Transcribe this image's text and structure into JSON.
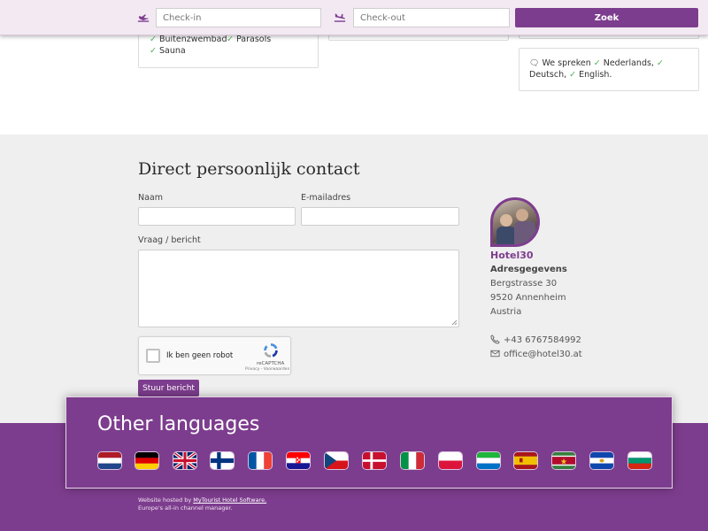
{
  "booking": {
    "checkin_placeholder": "Check-in",
    "checkout_placeholder": "Check-out",
    "search_label": "Zoek"
  },
  "amenities": [
    {
      "label": "Buitenzwembad"
    },
    {
      "label": "Parasols"
    },
    {
      "label": "Sauna"
    }
  ],
  "languages_spoken": {
    "intro": "We spreken",
    "items": [
      "Nederlands,",
      "Deutsch,",
      "English."
    ]
  },
  "contact": {
    "title": "Direct persoonlijk contact",
    "name_label": "Naam",
    "email_label": "E-mailadres",
    "question_label": "Vraag / bericht",
    "captcha_label": "Ik ben geen robot",
    "captcha_brand": "reCAPTCHA",
    "captcha_links": "Privacy - Voorwaarden",
    "send_label": "Stuur bericht"
  },
  "hotel": {
    "name": "Hotel30",
    "address_title": "Adresgegevens",
    "street": "Bergstrasse 30",
    "city": "9520 Annenheim",
    "country": "Austria",
    "phone": "+43 6767584992",
    "email": "office@hotel30.at"
  },
  "other_languages": {
    "title": "Other languages",
    "flags": [
      "flag-netherlands",
      "flag-germany",
      "flag-uk",
      "flag-finland",
      "flag-france",
      "flag-croatia",
      "flag-czech",
      "flag-denmark",
      "flag-italy",
      "flag-poland",
      "flag-sierra-leone",
      "flag-spain",
      "flag-suriname",
      "flag-el-salvador",
      "flag-bulgaria"
    ]
  },
  "footer": {
    "hosted_prefix": "Website hosted by",
    "hosted_link": "MyTourist Hotel Software.",
    "tagline": "Europe's all-in channel manager."
  },
  "colors": {
    "brand": "#7d3d8e",
    "check": "#4caf50",
    "section_bg": "#efefef"
  }
}
